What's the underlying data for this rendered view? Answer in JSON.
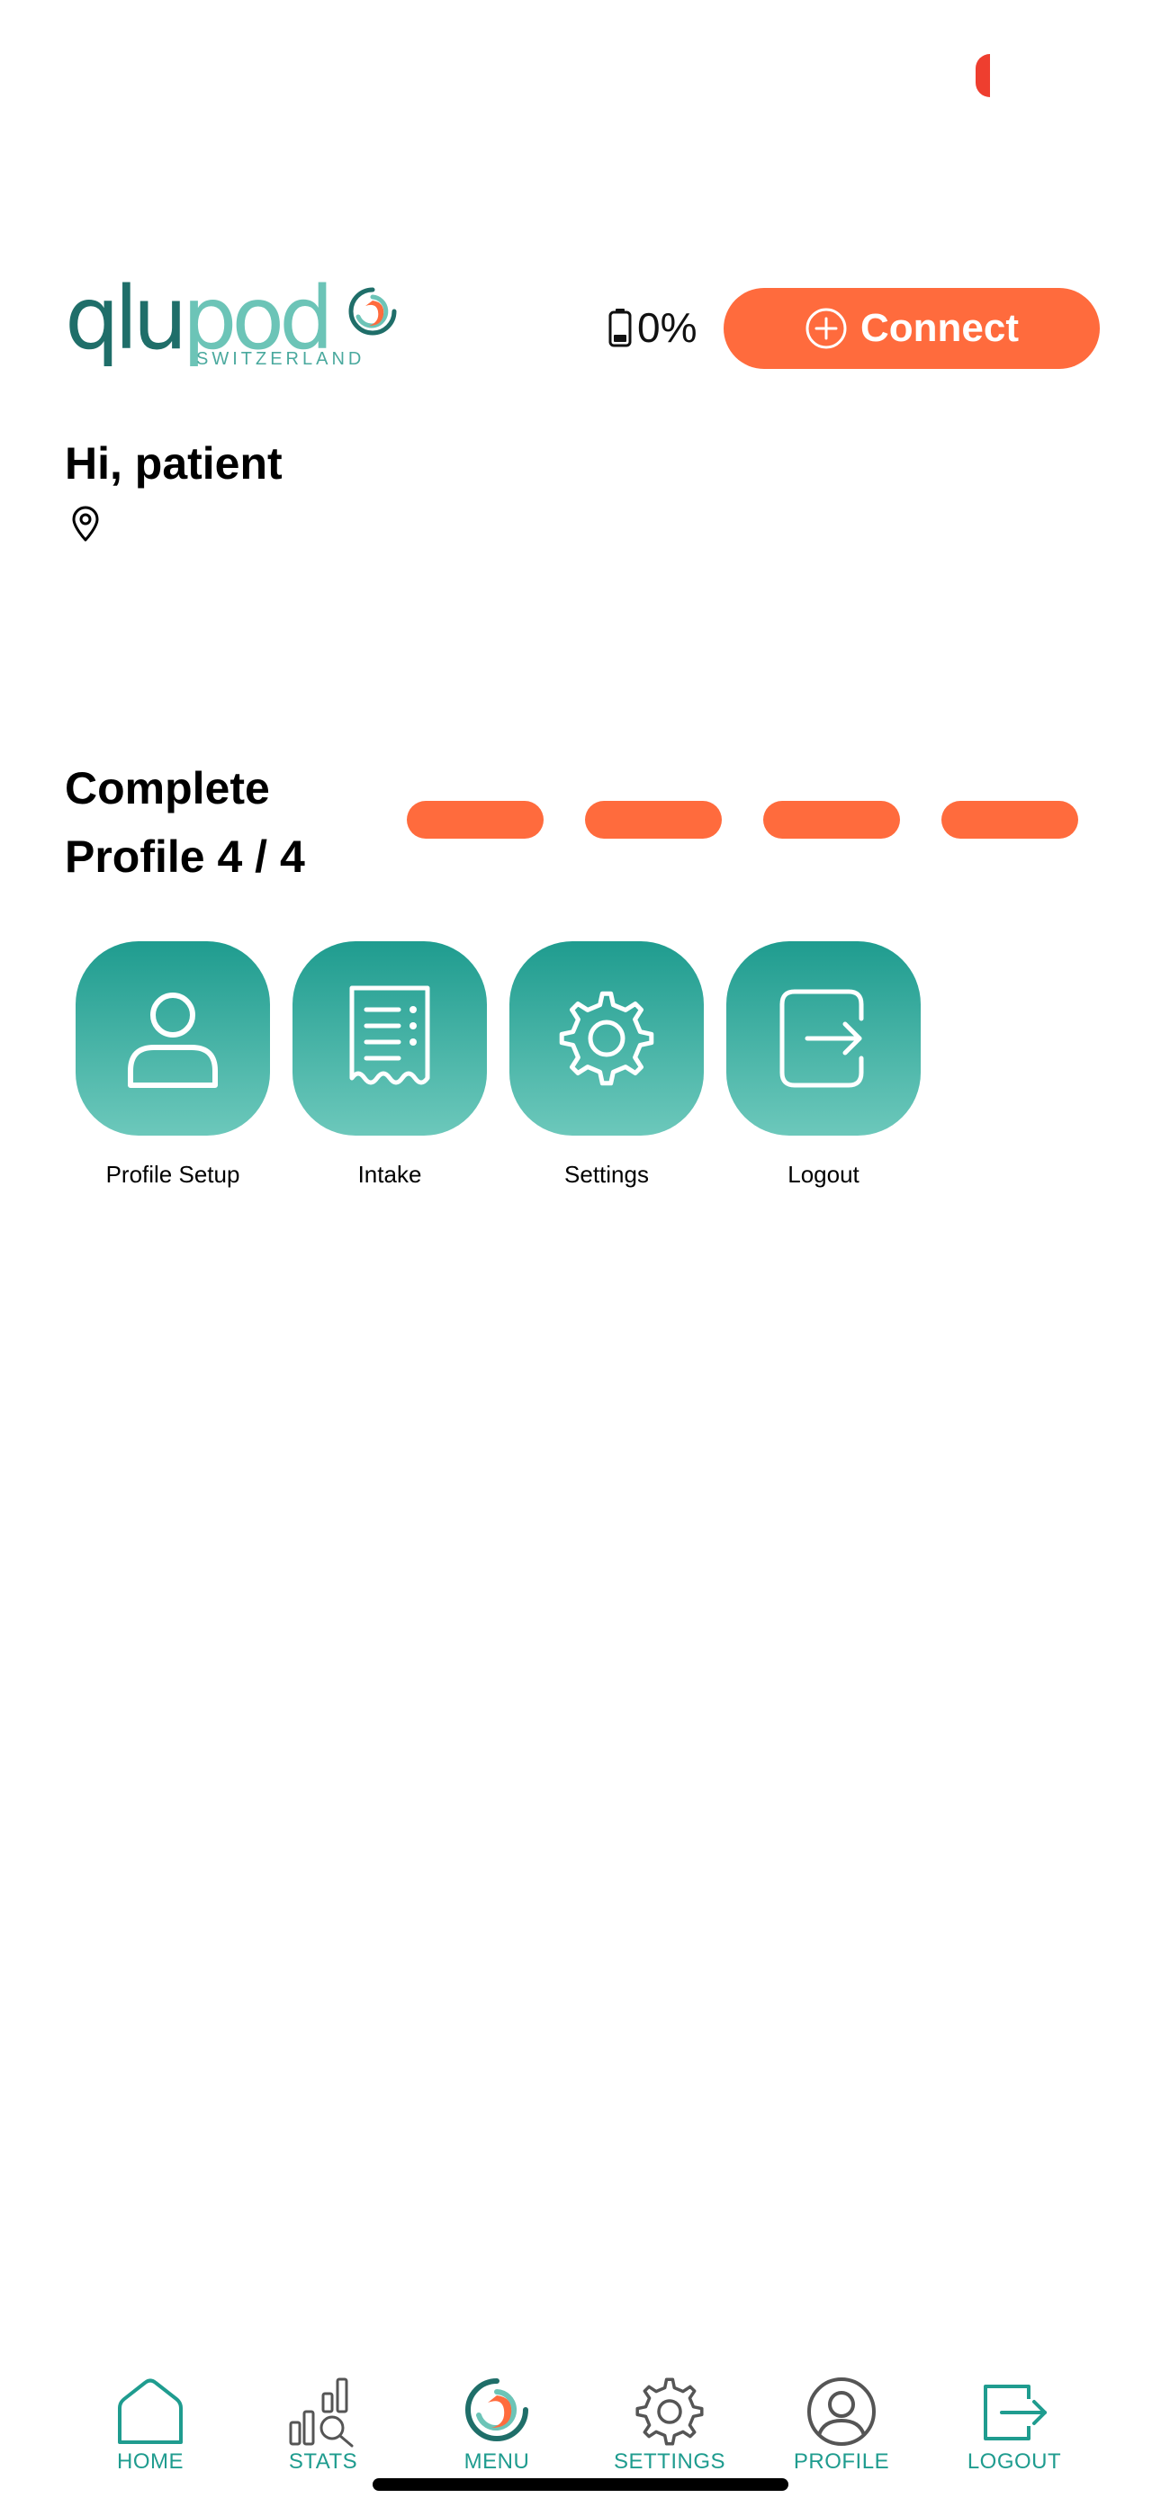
{
  "status": {
    "indicator_color": "#ee3e2f"
  },
  "header": {
    "logo": {
      "word_dark": "qlu",
      "word_light": "pod",
      "sub": "SWITZERLAND",
      "colors": [
        "#1f6e69",
        "#6cc4b7",
        "#ff6b3d"
      ]
    },
    "battery": {
      "icon": "battery-icon",
      "label": "0%",
      "level": 0
    },
    "connect_button": {
      "icon": "plus-circle-icon",
      "label": "Connect",
      "color": "#ff6b3d"
    }
  },
  "greeting": {
    "text": "Hi, patient",
    "location_icon": "location-pin-icon"
  },
  "profile_progress": {
    "title_line1": "Complete",
    "title_line2": "Profile 4 / 4",
    "completed": 4,
    "total": 4,
    "segment_color": "#ff6b3d"
  },
  "tiles": [
    {
      "label": "Profile Setup",
      "icon": "user-icon"
    },
    {
      "label": "Intake",
      "icon": "receipt-icon"
    },
    {
      "label": "Settings",
      "icon": "gear-icon"
    },
    {
      "label": "Logout",
      "icon": "logout-icon"
    }
  ],
  "bottom_nav": {
    "items": [
      {
        "label": "HOME",
        "icon": "home-icon"
      },
      {
        "label": "STATS",
        "icon": "stats-icon"
      },
      {
        "label": "MENU",
        "icon": "qlupod-logo-icon"
      },
      {
        "label": "SETTINGS",
        "icon": "gear-icon"
      },
      {
        "label": "PROFILE",
        "icon": "profile-icon"
      },
      {
        "label": "LOGOUT",
        "icon": "logout-icon"
      }
    ],
    "accent_color": "#1f9c8f"
  }
}
